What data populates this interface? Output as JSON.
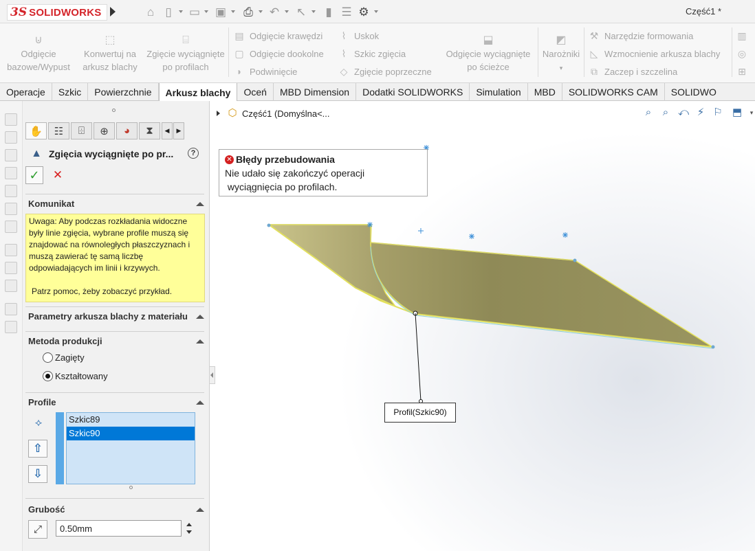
{
  "app": {
    "logo_ds": "3S",
    "logo_text": "SOLIDWORKS",
    "document_title": "Część1 *"
  },
  "ribbon": {
    "buttons": [
      {
        "label_1": "Odgięcie",
        "label_2": "bazowe/Wypust"
      },
      {
        "label_1": "Konwertuj na",
        "label_2": "arkusz blachy"
      },
      {
        "label_1": "Zgięcie wyciągnięte",
        "label_2": "po profilach"
      },
      {
        "label_1": "Odgięcie wyciągnięte",
        "label_2": "po ścieżce"
      },
      {
        "label_1": "Narożniki",
        "label_2": ""
      }
    ],
    "small": [
      "Odgięcie krawędzi",
      "Odgięcie dookolne",
      "Podwinięcie",
      "Uskok",
      "Szkic zgięcia",
      "Zgięcie poprzeczne",
      "Narzędzie formowania",
      "Wzmocnienie arkusza blachy",
      "Zaczep i szczelina"
    ]
  },
  "tabs": [
    {
      "label": "Operacje",
      "active": false
    },
    {
      "label": "Szkic",
      "active": false
    },
    {
      "label": "Powierzchnie",
      "active": false
    },
    {
      "label": "Arkusz blachy",
      "active": true
    },
    {
      "label": "Oceń",
      "active": false
    },
    {
      "label": "MBD Dimension",
      "active": false
    },
    {
      "label": "Dodatki SOLIDWORKS",
      "active": false
    },
    {
      "label": "Simulation",
      "active": false
    },
    {
      "label": "MBD",
      "active": false
    },
    {
      "label": "SOLIDWORKS CAM",
      "active": false
    },
    {
      "label": "SOLIDWO",
      "active": false
    }
  ],
  "property_manager": {
    "title": "Zgięcia wyciągnięte po pr...",
    "help": "?",
    "sections": {
      "message": {
        "heading": "Komunikat",
        "text_1": "Uwaga: Aby podczas rozkładania widoczne były linie zgięcia, wybrane profile muszą się znajdować na równoległych płaszczyznach i muszą zawierać tę samą liczbę odpowiadających im linii i krzywych.",
        "text_2": "Patrz pomoc, żeby zobaczyć przykład."
      },
      "sheet_params": {
        "heading": "Parametry arkusza blachy z materiału"
      },
      "production": {
        "heading": "Metoda produkcji",
        "options": [
          {
            "label": "Zagięty",
            "checked": false
          },
          {
            "label": "Kształtowany",
            "checked": true
          }
        ]
      },
      "profiles": {
        "heading": "Profile",
        "items": [
          {
            "label": "Szkic89",
            "selected": false
          },
          {
            "label": "Szkic90",
            "selected": true
          }
        ]
      },
      "thickness": {
        "heading": "Grubość",
        "value": "0.50mm"
      }
    }
  },
  "viewport": {
    "tree_label": "Część1  (Domyślna<...",
    "error": {
      "title": "Błędy przebudowania",
      "line_1": "Nie udało się zakończyć operacji",
      "line_2": " wyciągnięcia po profilach."
    },
    "callout": "Profil(Szkic90)"
  },
  "colors": {
    "sheet_face": "#9a9460",
    "sheet_edge": "#e6e35a",
    "sketch_point": "#3c8fd8",
    "selection": "#0078d7",
    "message_bg": "#ffff99"
  }
}
